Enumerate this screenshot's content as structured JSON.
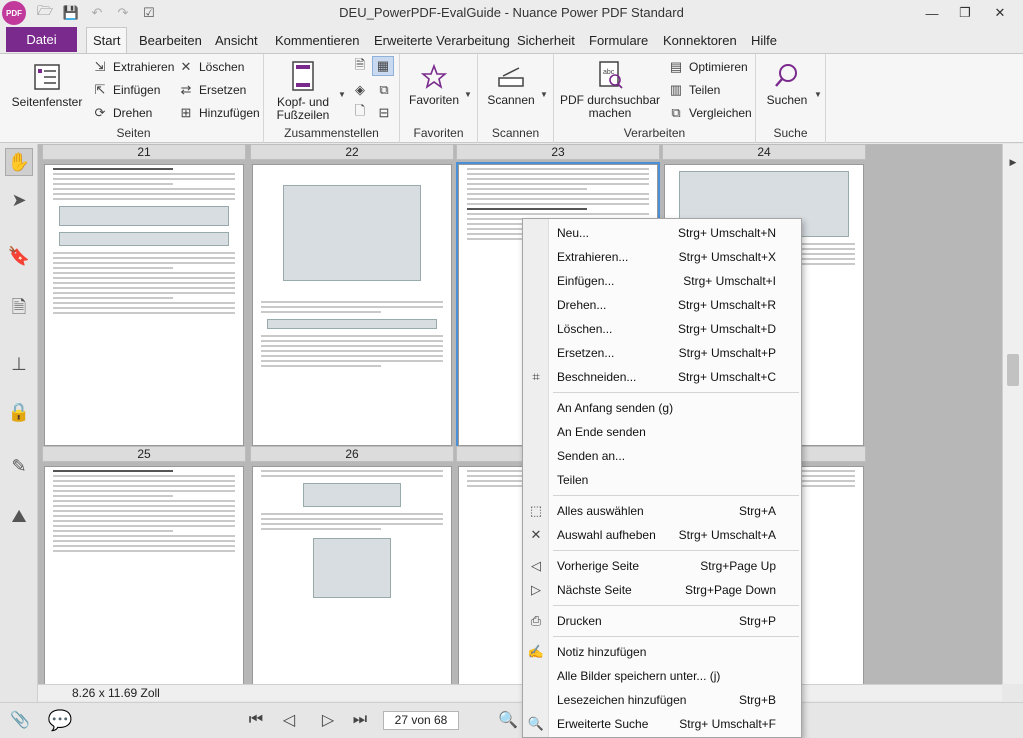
{
  "window": {
    "title": "DEU_PowerPDF-EvalGuide - Nuance Power PDF Standard",
    "logo_text": "PDF"
  },
  "menu_tabs": {
    "file": "Datei",
    "tabs": [
      "Start",
      "Bearbeiten",
      "Ansicht",
      "Kommentieren",
      "Erweiterte Verarbeitung",
      "Sicherheit",
      "Formulare",
      "Konnektoren",
      "Hilfe"
    ]
  },
  "ribbon": {
    "seiten": {
      "label": "Seiten",
      "seitenfenster": "Seitenfenster",
      "extrahieren": "Extrahieren",
      "einfuegen": "Einfügen",
      "drehen": "Drehen",
      "loeschen": "Löschen",
      "ersetzen": "Ersetzen",
      "hinzufuegen": "Hinzufügen"
    },
    "zusammenstellen": {
      "label": "Zusammenstellen",
      "kopf_line1": "Kopf- und",
      "kopf_line2": "Fußzeilen"
    },
    "favoriten": {
      "label": "Favoriten",
      "button": "Favoriten"
    },
    "scannen": {
      "label": "Scannen",
      "button": "Scannen"
    },
    "verarbeiten": {
      "label": "Verarbeiten",
      "pdf_line1": "PDF durchsuchbar",
      "pdf_line2": "machen",
      "optimieren": "Optimieren",
      "teilen": "Teilen",
      "vergleichen": "Vergleichen"
    },
    "suche": {
      "label": "Suche",
      "button": "Suchen"
    }
  },
  "document": {
    "columns": [
      "21",
      "22",
      "23",
      "24"
    ],
    "row2_columns": [
      "25",
      "26"
    ],
    "page_size": "8.26 x 11.69 Zoll",
    "page_indicator": "27 von 68"
  },
  "context_menu": {
    "items": [
      {
        "label": "Neu...",
        "shortcut": "Strg+ Umschalt+N"
      },
      {
        "label": "Extrahieren...",
        "shortcut": "Strg+ Umschalt+X"
      },
      {
        "label": "Einfügen...",
        "shortcut": "Strg+ Umschalt+I"
      },
      {
        "label": "Drehen...",
        "shortcut": "Strg+ Umschalt+R"
      },
      {
        "label": "Löschen...",
        "shortcut": "Strg+ Umschalt+D"
      },
      {
        "label": "Ersetzen...",
        "shortcut": "Strg+ Umschalt+P"
      },
      {
        "label": "Beschneiden...",
        "shortcut": "Strg+ Umschalt+C"
      },
      {
        "label": "An Anfang senden (g)",
        "shortcut": ""
      },
      {
        "label": "An Ende senden",
        "shortcut": ""
      },
      {
        "label": "Senden an...",
        "shortcut": ""
      },
      {
        "label": "Teilen",
        "shortcut": ""
      },
      {
        "label": "Alles auswählen",
        "shortcut": "Strg+A"
      },
      {
        "label": "Auswahl aufheben",
        "shortcut": "Strg+ Umschalt+A"
      },
      {
        "label": "Vorherige Seite",
        "shortcut": "Strg+Page Up"
      },
      {
        "label": "Nächste Seite",
        "shortcut": "Strg+Page Down"
      },
      {
        "label": "Drucken",
        "shortcut": "Strg+P"
      },
      {
        "label": "Notiz hinzufügen",
        "shortcut": ""
      },
      {
        "label": "Alle Bilder speichern unter... (j)",
        "shortcut": ""
      },
      {
        "label": "Lesezeichen hinzufügen",
        "shortcut": "Strg+B"
      },
      {
        "label": "Erweiterte Suche",
        "shortcut": "Strg+ Umschalt+F"
      }
    ]
  }
}
